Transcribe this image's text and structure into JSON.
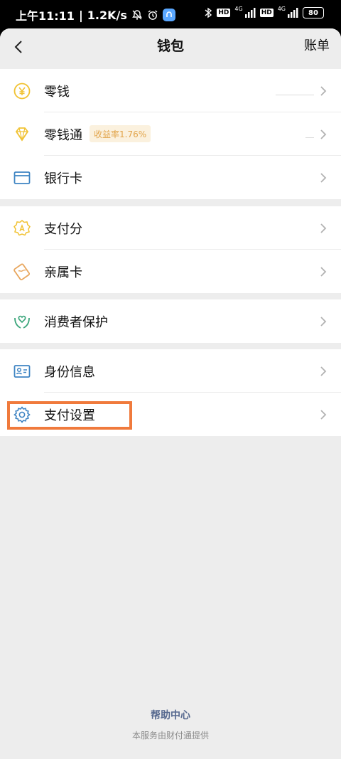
{
  "status_bar": {
    "time": "上午11:11",
    "speed": "1.2K/s",
    "battery": "80",
    "sim1": "4G",
    "sim2": "4G",
    "hd": "HD"
  },
  "nav": {
    "title": "钱包",
    "right": "账单"
  },
  "groups": [
    {
      "items": [
        {
          "label": "零钱",
          "icon": "coin-yen-icon"
        },
        {
          "label": "零钱通",
          "icon": "diamond-icon",
          "badge": "收益率1.76%"
        },
        {
          "label": "银行卡",
          "icon": "bank-card-icon"
        }
      ]
    },
    {
      "items": [
        {
          "label": "支付分",
          "icon": "pay-score-badge-icon"
        },
        {
          "label": "亲属卡",
          "icon": "family-card-icon"
        }
      ]
    },
    {
      "items": [
        {
          "label": "消费者保护",
          "icon": "consumer-protection-icon"
        }
      ]
    },
    {
      "items": [
        {
          "label": "身份信息",
          "icon": "id-card-icon"
        },
        {
          "label": "支付设置",
          "icon": "gear-icon"
        }
      ]
    }
  ],
  "footer": {
    "help": "帮助中心",
    "note": "本服务由财付通提供"
  },
  "colors": {
    "accent_yellow": "#f1c232",
    "accent_blue": "#3e84c3",
    "accent_green": "#3aa57a",
    "highlight": "#f07a3c",
    "link": "#56698f"
  }
}
